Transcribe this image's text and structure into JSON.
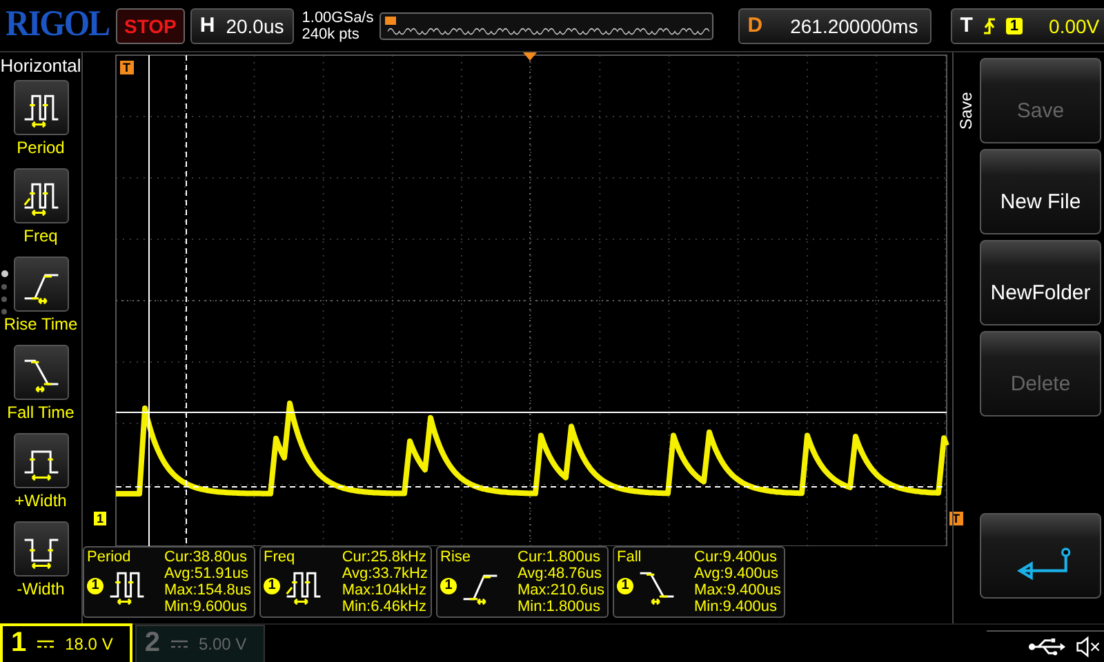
{
  "header": {
    "logo": "RIGOL",
    "run_state": "STOP",
    "timebase": {
      "label": "H",
      "value": "20.0us"
    },
    "sample_rate": "1.00GSa/s",
    "memory_depth": "240k pts",
    "delay": {
      "label": "D",
      "value": "261.200000ms"
    },
    "trigger": {
      "label": "T",
      "source": "1",
      "level": "0.00V"
    }
  },
  "left_menu": {
    "title": "Horizontal",
    "items": [
      {
        "label": "Period",
        "kind": "period"
      },
      {
        "label": "Freq",
        "kind": "freq"
      },
      {
        "label": "Rise Time",
        "kind": "rise"
      },
      {
        "label": "Fall Time",
        "kind": "fall"
      },
      {
        "label": "+Width",
        "kind": "pos_width"
      },
      {
        "label": "-Width",
        "kind": "neg_width"
      }
    ],
    "pages": [
      {
        "selected": true
      },
      {
        "selected": false
      },
      {
        "selected": false
      },
      {
        "selected": false
      }
    ]
  },
  "plot": {
    "trigger_position_marker": "T",
    "channel_marker": "1",
    "trigger_level_marker": "T"
  },
  "measurements": [
    {
      "name": "Period",
      "channel": "1",
      "kind": "period",
      "lines": [
        "Cur:38.80us",
        "Avg:51.91us",
        "Max:154.8us",
        "Min:9.600us"
      ]
    },
    {
      "name": "Freq",
      "channel": "1",
      "kind": "freq",
      "lines": [
        "Cur:25.8kHz",
        "Avg:33.7kHz",
        "Max:104kHz",
        "Min:6.46kHz"
      ]
    },
    {
      "name": "Rise",
      "channel": "1",
      "kind": "rise",
      "lines": [
        "Cur:1.800us",
        "Avg:48.76us",
        "Max:210.6us",
        "Min:1.800us"
      ]
    },
    {
      "name": "Fall",
      "channel": "1",
      "kind": "fall",
      "lines": [
        "Cur:9.400us",
        "Avg:9.400us",
        "Max:9.400us",
        "Min:9.400us"
      ]
    }
  ],
  "channels": [
    {
      "number": "1",
      "scale": "18.0 V",
      "selected": true
    },
    {
      "number": "2",
      "scale": "5.00 V",
      "selected": false
    }
  ],
  "right_menu": {
    "title": "Save",
    "buttons": [
      {
        "kind": "text",
        "label": "Save",
        "disabled": true
      },
      {
        "kind": "text",
        "label": "New File",
        "disabled": false
      },
      {
        "kind": "text",
        "label": "NewFolder",
        "disabled": false
      },
      {
        "kind": "text",
        "label": "Delete",
        "disabled": true
      },
      {
        "kind": "spacer"
      },
      {
        "kind": "back"
      }
    ]
  }
}
